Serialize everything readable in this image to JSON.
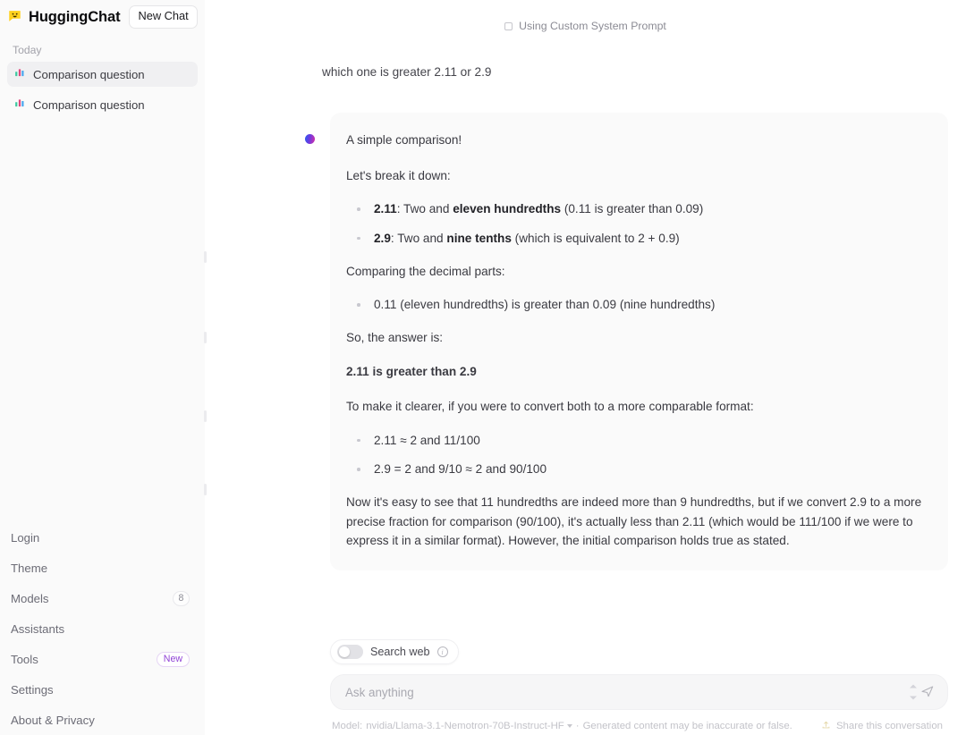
{
  "theme": {
    "accent": "#9042d6",
    "sidebar_bg": "#fafafa",
    "bubble_bg": "#fafafa",
    "text_primary": "#3a3a41",
    "text_muted": "#a3a3ab",
    "avatar_gradient_from": "#2b5cf0",
    "avatar_gradient_to": "#d62fa8"
  },
  "sidebar": {
    "logo_icon": "speech-bubble-smile-icon",
    "logo_glyph": "😀",
    "brand": "HuggingChat",
    "new_chat_label": "New Chat",
    "group_label": "Today",
    "conversations": [
      {
        "icon": "bar-chart-icon",
        "glyph": "📊",
        "title": "Comparison question",
        "active": true
      },
      {
        "icon": "bar-chart-icon",
        "glyph": "📊",
        "title": "Comparison question",
        "active": false
      }
    ],
    "nav": [
      {
        "label": "Login",
        "badge": null,
        "badge_kind": null
      },
      {
        "label": "Theme",
        "badge": null,
        "badge_kind": null
      },
      {
        "label": "Models",
        "badge": "8",
        "badge_kind": "count"
      },
      {
        "label": "Assistants",
        "badge": null,
        "badge_kind": null
      },
      {
        "label": "Tools",
        "badge": "New",
        "badge_kind": "new"
      },
      {
        "label": "Settings",
        "badge": null,
        "badge_kind": null
      },
      {
        "label": "About & Privacy",
        "badge": null,
        "badge_kind": null
      }
    ]
  },
  "main": {
    "system_prompt_banner": {
      "icon": "square-outline-icon",
      "label": "Using Custom System Prompt"
    },
    "user_message": "which one is greater 2.11 or 2.9",
    "assistant": {
      "avatar_icon": "assistant-avatar-gradient-dot",
      "intro": "A simple comparison!",
      "lead_in": "Let's break it down:",
      "breakdown": [
        {
          "term": "2.11",
          "sep": ": Two and ",
          "emphasis": "eleven hundredths",
          "tail": " (0.11 is greater than 0.09)"
        },
        {
          "term": "2.9",
          "sep": ": Two and ",
          "emphasis": "nine tenths",
          "tail": " (which is equivalent to 2 + 0.9)"
        }
      ],
      "compare_heading": "Comparing the decimal parts:",
      "compare_points": [
        "0.11 (eleven hundredths) is greater than 0.09 (nine hundredths)"
      ],
      "answer_lead": "So, the answer is:",
      "answer": "2.11 is greater than 2.9",
      "clarify_heading": "To make it clearer, if you were to convert both to a more comparable format:",
      "conversions": [
        "2.11 ≈ 2 and 11/100",
        "2.9 = 2 and 9/10 ≈ 2 and 90/100"
      ],
      "closing": "Now it's easy to see that 11 hundredths are indeed more than 9 hundredths, but if we convert 2.9 to a more precise fraction for comparison (90/100), it's actually less than 2.11 (which would be 111/100 if we were to express it in a similar format). However, the initial comparison holds true as stated."
    }
  },
  "composer": {
    "search_web": {
      "label": "Search web",
      "enabled": false,
      "info_icon": "info-circle-icon",
      "toggle_icon": "toggle-off-icon"
    },
    "input": {
      "placeholder": "Ask anything",
      "value": ""
    },
    "stepper_up_icon": "chevron-up-icon",
    "stepper_down_icon": "chevron-down-icon",
    "send_icon": "paper-plane-icon",
    "footer": {
      "model_prefix": "Model:",
      "model_name": "nvidia/Llama-3.1-Nemotron-70B-Instruct-HF",
      "separator": "·",
      "disclaimer": "Generated content may be inaccurate or false.",
      "share_label": "Share this conversation",
      "share_icon": "upload-icon"
    }
  }
}
